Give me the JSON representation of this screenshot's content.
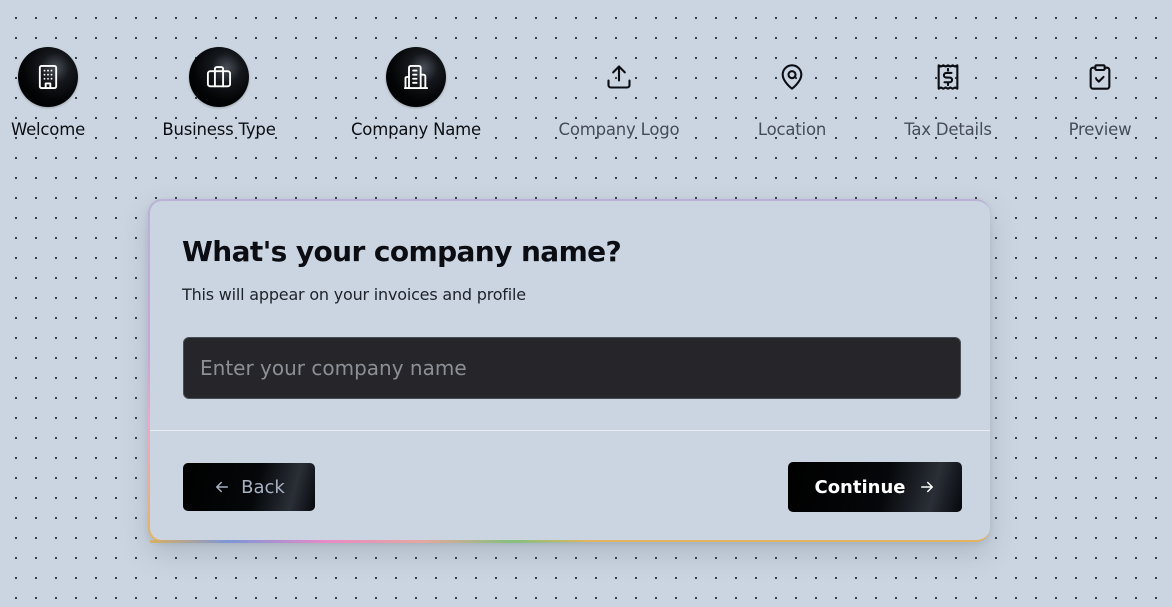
{
  "stepper": {
    "steps": [
      {
        "label": "Welcome",
        "icon": "building-icon",
        "state": "complete"
      },
      {
        "label": "Business Type",
        "icon": "briefcase-icon",
        "state": "complete"
      },
      {
        "label": "Company Name",
        "icon": "building-2-icon",
        "state": "current"
      },
      {
        "label": "Company Logo",
        "icon": "upload-icon",
        "state": "upcoming"
      },
      {
        "label": "Location",
        "icon": "map-pin-icon",
        "state": "upcoming"
      },
      {
        "label": "Tax Details",
        "icon": "receipt-icon",
        "state": "upcoming"
      },
      {
        "label": "Preview",
        "icon": "clipboard-check-icon",
        "state": "upcoming"
      }
    ]
  },
  "card": {
    "title": "What's your company name?",
    "subtitle": "This will appear on your invoices and profile",
    "input": {
      "placeholder": "Enter your company name",
      "value": ""
    },
    "back_label": "Back",
    "continue_label": "Continue"
  },
  "colors": {
    "background": "#cbd5e1",
    "input_background": "#26262a",
    "button_background": "#000000",
    "accent_gradient": [
      "#d9b060",
      "#7d96d8",
      "#e88ac6",
      "#85c07c"
    ]
  }
}
